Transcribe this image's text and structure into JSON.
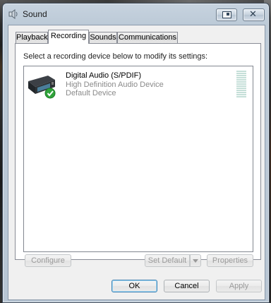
{
  "window": {
    "title": "Sound",
    "help_button_label": "",
    "close_button_label": "✕"
  },
  "tabs": [
    {
      "label": "Playback",
      "active": false
    },
    {
      "label": "Recording",
      "active": true
    },
    {
      "label": "Sounds",
      "active": false
    },
    {
      "label": "Communications",
      "active": false
    }
  ],
  "panel": {
    "instruction": "Select a recording device below to modify its settings:",
    "devices": [
      {
        "name": "Digital Audio (S/PDIF)",
        "description": "High Definition Audio Device",
        "status": "Default Device",
        "icon": "digital-audio-device-icon",
        "default_badge": "green-checkmark-icon",
        "level_fraction": 0
      }
    ],
    "buttons": {
      "configure": "Configure",
      "set_default": "Set Default",
      "properties": "Properties"
    }
  },
  "footer": {
    "ok": "OK",
    "cancel": "Cancel",
    "apply": "Apply"
  },
  "colors": {
    "frame": "#bccad7",
    "selected_tab": "#ffffff",
    "meter_segment": "#c5dfd8",
    "check_badge": "#2fa33a"
  }
}
